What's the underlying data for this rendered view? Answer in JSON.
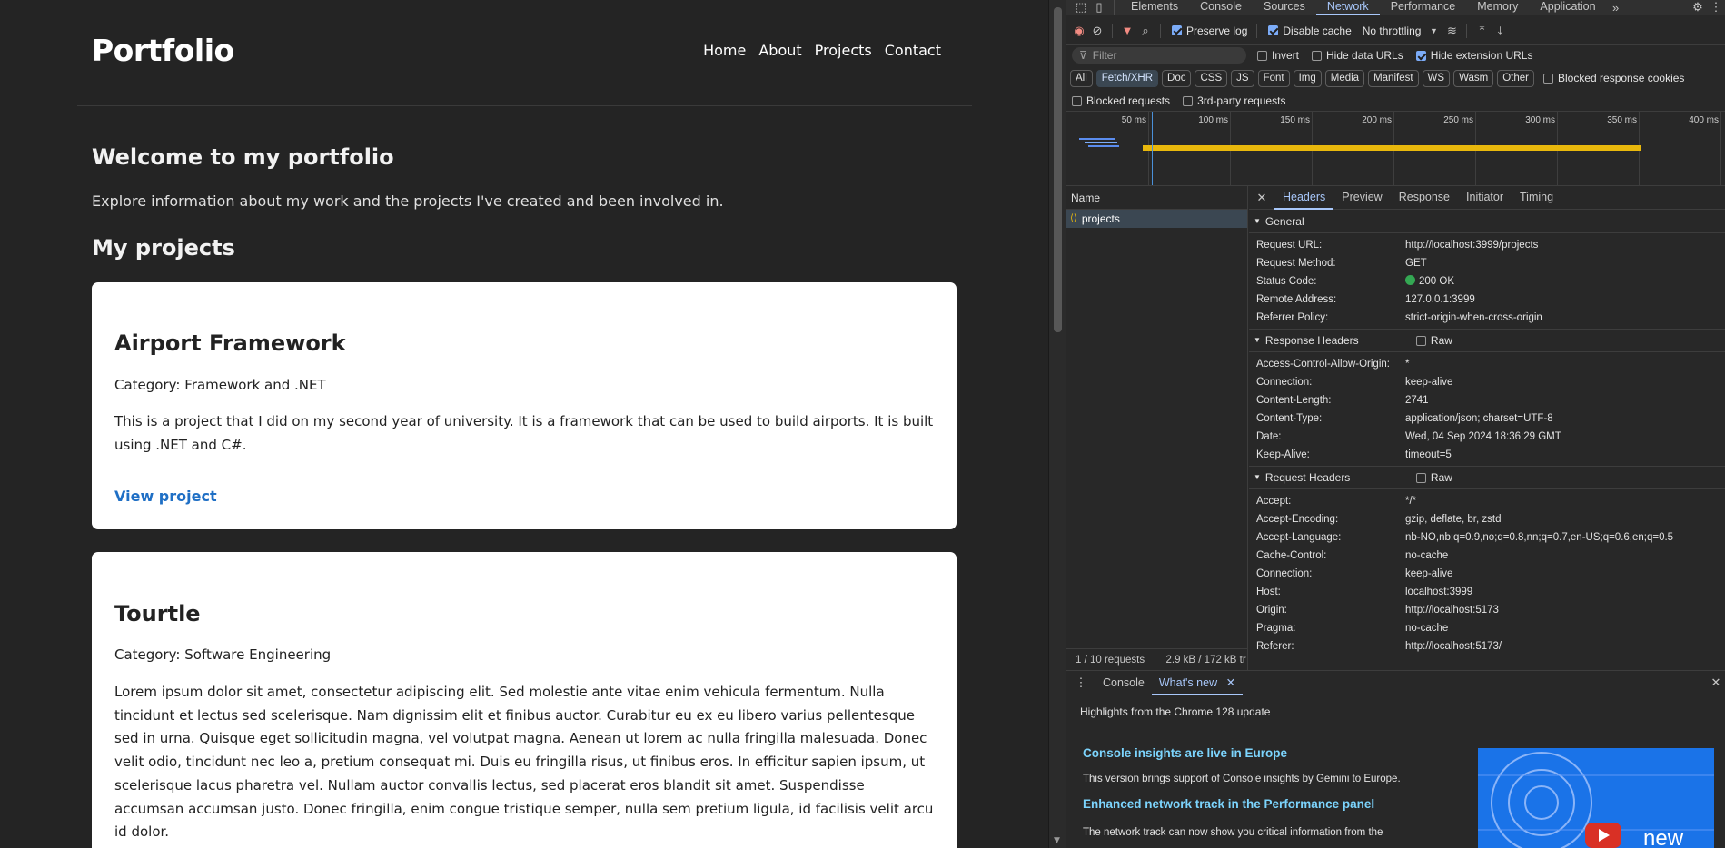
{
  "site": {
    "brand": "Portfolio",
    "nav": [
      "Home",
      "About",
      "Projects",
      "Contact"
    ],
    "welcome_title": "Welcome to my portfolio",
    "welcome_text": "Explore information about my work and the projects I've created and been involved in.",
    "projects_title": "My projects",
    "projects": [
      {
        "title": "Airport Framework",
        "category": "Category: Framework and .NET",
        "description": "This is a project that I did on my second year of university. It is a framework that can be used to build airports. It is built using .NET and C#.",
        "link": "View project"
      },
      {
        "title": "Tourtle",
        "category": "Category: Software Engineering",
        "description": "Lorem ipsum dolor sit amet, consectetur adipiscing elit. Sed molestie ante vitae enim vehicula fermentum. Nulla tincidunt et lectus sed scelerisque. Nam dignissim elit et finibus auctor. Curabitur eu ex eu libero varius pellentesque sed in urna. Quisque eget sollicitudin magna, vel volutpat magna. Aenean ut lorem ac nulla fringilla malesuada. Donec velit odio, tincidunt nec leo a, pretium consequat mi. Duis eu fringilla risus, ut finibus eros. In efficitur sapien ipsum, ut scelerisque lacus pharetra vel. Nullam auctor convallis lectus, sed placerat eros blandit sit amet. Suspendisse accumsan accumsan justo. Donec fringilla, enim congue tristique semper, nulla sem pretium ligula, id facilisis velit arcu id dolor."
      }
    ]
  },
  "devtools": {
    "tabs": [
      "Elements",
      "Console",
      "Sources",
      "Network",
      "Performance",
      "Memory",
      "Application"
    ],
    "active_tab": "Network",
    "toolbar": {
      "preserve_log": "Preserve log",
      "disable_cache": "Disable cache",
      "throttling": "No throttling"
    },
    "filter": {
      "placeholder": "Filter",
      "invert": "Invert",
      "hide_data_urls": "Hide data URLs",
      "hide_extension_urls": "Hide extension URLs"
    },
    "types": [
      "All",
      "Fetch/XHR",
      "Doc",
      "CSS",
      "JS",
      "Font",
      "Img",
      "Media",
      "Manifest",
      "WS",
      "Wasm",
      "Other"
    ],
    "blocked_response_cookies": "Blocked response cookies",
    "blocked_requests": "Blocked requests",
    "third_party": "3rd-party requests",
    "timeline_ticks": [
      "50 ms",
      "100 ms",
      "150 ms",
      "200 ms",
      "250 ms",
      "300 ms",
      "350 ms",
      "400 ms"
    ],
    "name_header": "Name",
    "request_name": "projects",
    "footer": "1 / 10 requests",
    "footer_size": "2.9 kB / 172 kB tr",
    "detail_tabs": [
      "Headers",
      "Preview",
      "Response",
      "Initiator",
      "Timing"
    ],
    "general_title": "General",
    "general": [
      {
        "k": "Request URL:",
        "v": "http://localhost:3999/projects"
      },
      {
        "k": "Request Method:",
        "v": "GET"
      },
      {
        "k": "Status Code:",
        "v": "200 OK"
      },
      {
        "k": "Remote Address:",
        "v": "127.0.0.1:3999"
      },
      {
        "k": "Referrer Policy:",
        "v": "strict-origin-when-cross-origin"
      }
    ],
    "response_headers_title": "Response Headers",
    "raw": "Raw",
    "response_headers": [
      {
        "k": "Access-Control-Allow-Origin:",
        "v": "*"
      },
      {
        "k": "Connection:",
        "v": "keep-alive"
      },
      {
        "k": "Content-Length:",
        "v": "2741"
      },
      {
        "k": "Content-Type:",
        "v": "application/json; charset=UTF-8"
      },
      {
        "k": "Date:",
        "v": "Wed, 04 Sep 2024 18:36:29 GMT"
      },
      {
        "k": "Keep-Alive:",
        "v": "timeout=5"
      }
    ],
    "request_headers_title": "Request Headers",
    "request_headers": [
      {
        "k": "Accept:",
        "v": "*/*"
      },
      {
        "k": "Accept-Encoding:",
        "v": "gzip, deflate, br, zstd"
      },
      {
        "k": "Accept-Language:",
        "v": "nb-NO,nb;q=0.9,no;q=0.8,nn;q=0.7,en-US;q=0.6,en;q=0.5"
      },
      {
        "k": "Cache-Control:",
        "v": "no-cache"
      },
      {
        "k": "Connection:",
        "v": "keep-alive"
      },
      {
        "k": "Host:",
        "v": "localhost:3999"
      },
      {
        "k": "Origin:",
        "v": "http://localhost:5173"
      },
      {
        "k": "Pragma:",
        "v": "no-cache"
      },
      {
        "k": "Referer:",
        "v": "http://localhost:5173/"
      }
    ],
    "drawer_tabs": [
      "Console",
      "What's new"
    ],
    "whats_new": {
      "highlight": "Highlights from the Chrome 128 update",
      "item1_title": "Console insights are live in Europe",
      "item1_text": "This version brings support of Console insights by Gemini to Europe.",
      "item2_title": "Enhanced network track in the Performance panel",
      "item2_text": "The network track can now show you critical information from the",
      "image_text": "new"
    }
  }
}
